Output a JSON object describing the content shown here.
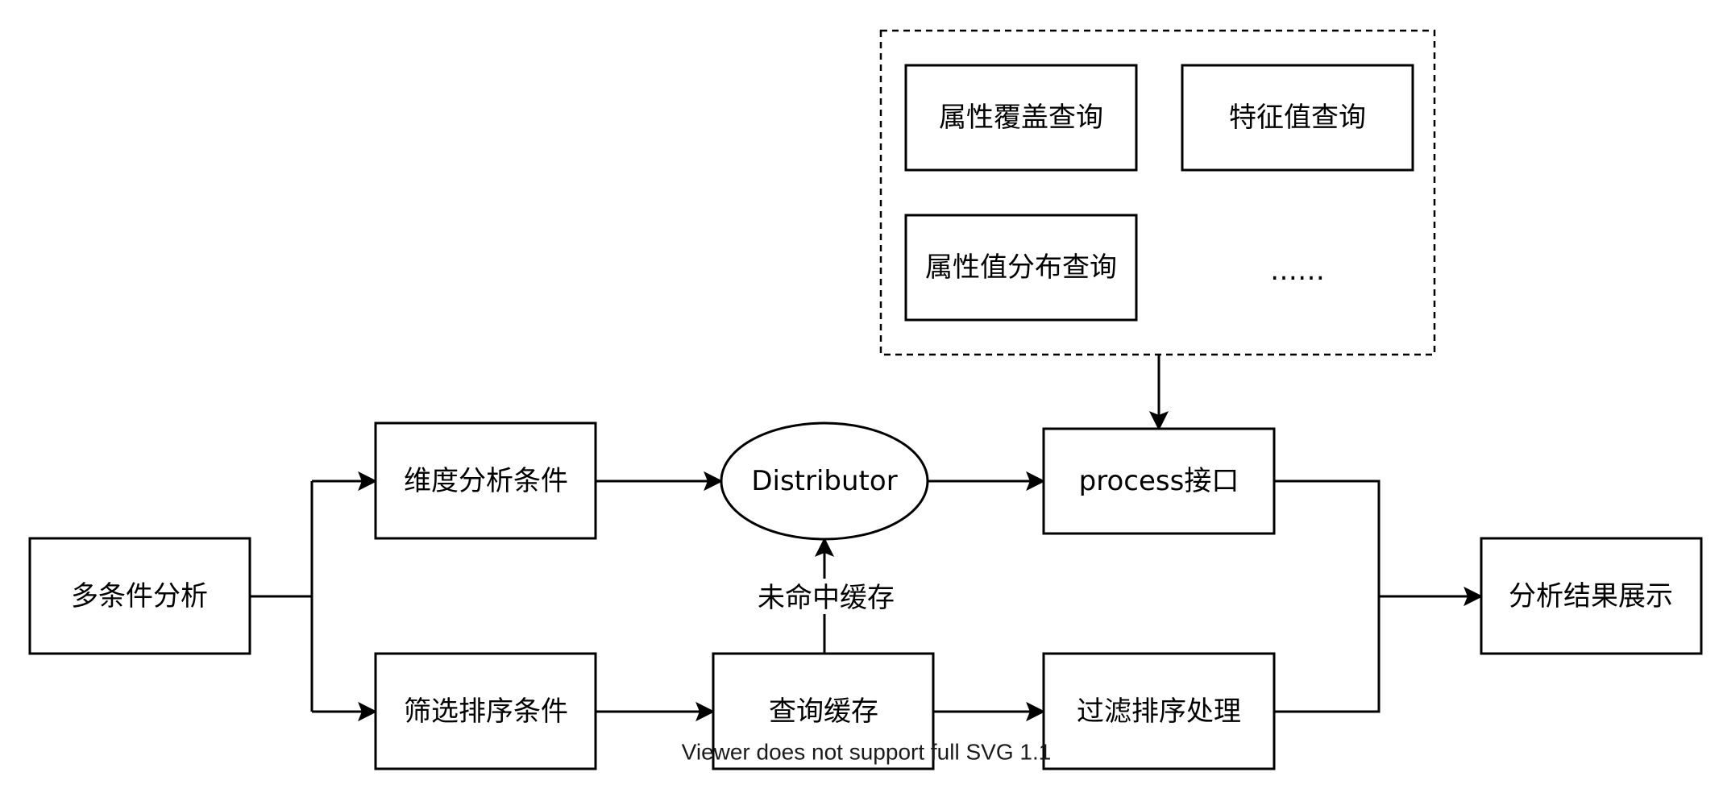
{
  "nodes": {
    "multi_condition": "多条件分析",
    "dimension_condition": "维度分析条件",
    "filter_sort_condition": "筛选排序条件",
    "distributor": "Distributor",
    "query_cache": "查询缓存",
    "process_interface": "process接口",
    "filter_sort_processing": "过滤排序处理",
    "result_display": "分析结果展示",
    "attr_coverage_query": "属性覆盖查询",
    "feature_value_query": "特征值查询",
    "attr_value_distribution_query": "属性值分布查询",
    "more_ellipsis": "……"
  },
  "edges": {
    "cache_miss_label": "未命中缓存"
  },
  "footer": {
    "svg_notice": "Viewer does not support full SVG 1.1"
  }
}
